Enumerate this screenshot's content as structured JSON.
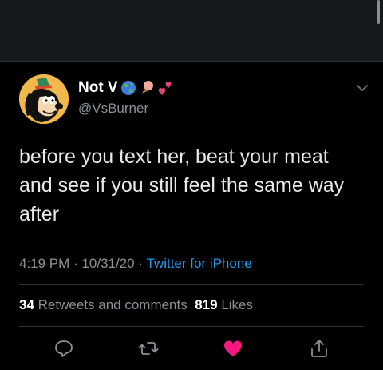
{
  "tweet": {
    "display_name": "Not V",
    "name_emojis": [
      "globe-icon",
      "ice-cream-icon",
      "two-hearts-icon"
    ],
    "handle": "@VsBurner",
    "text": "before you text her, beat your meat and see if you still feel the same way after",
    "time": "4:19 PM",
    "date": "10/31/20",
    "separator": "·",
    "source": "Twitter for iPhone"
  },
  "stats": {
    "retweets_count": "34",
    "retweets_label": "Retweets and comments",
    "likes_count": "819",
    "likes_label": "Likes"
  },
  "actions": {
    "icons": [
      "reply-icon",
      "retweet-icon",
      "like-icon",
      "share-icon"
    ],
    "like_color": "#f91880"
  },
  "colors": {
    "background": "#000000",
    "link": "#1d9bf0",
    "secondary_text": "#8b9197"
  }
}
